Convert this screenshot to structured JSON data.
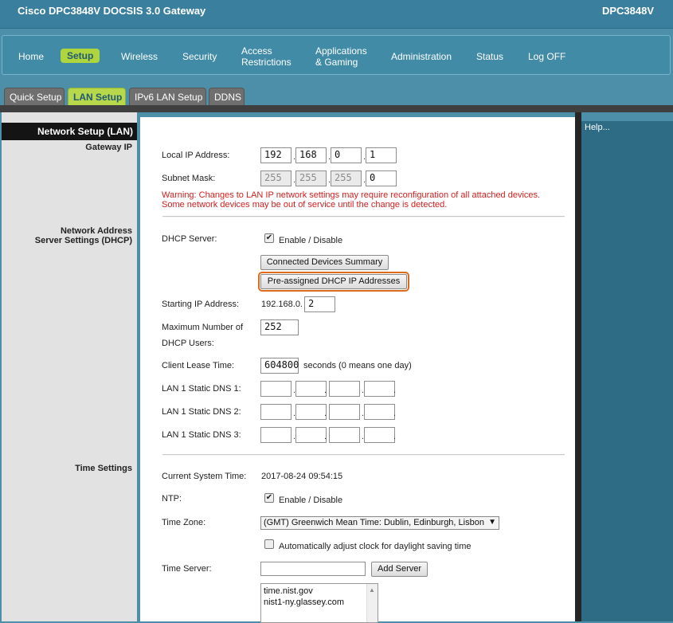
{
  "header": {
    "product": "Cisco DPC3848V DOCSIS 3.0 Gateway",
    "model": "DPC3848V"
  },
  "nav": {
    "home": "Home",
    "setup": "Setup",
    "wireless": "Wireless",
    "security": "Security",
    "access_1": "Access",
    "access_2": "Restrictions",
    "apps_1": "Applications",
    "apps_2": "& Gaming",
    "administration": "Administration",
    "status": "Status",
    "logoff": "Log OFF"
  },
  "tabs": {
    "quick": "Quick Setup",
    "lan": "LAN Setup",
    "ipv6": "IPv6 LAN Setup",
    "ddns": "DDNS"
  },
  "left": {
    "section_title": "Network Setup (LAN)",
    "gateway_ip": "Gateway IP",
    "dhcp_1": "Network Address",
    "dhcp_2": "Server Settings (DHCP)",
    "time": "Time Settings"
  },
  "help": "Help...",
  "gateway": {
    "local_ip_label": "Local IP Address:",
    "local_ip": [
      "192",
      "168",
      "0",
      "1"
    ],
    "subnet_label": "Subnet Mask:",
    "subnet": [
      "255",
      "255",
      "255",
      "0"
    ],
    "warning_1": "Warning: Changes to LAN IP network settings may require reconfiguration of all attached devices.",
    "warning_2": "Some network devices may be out of service until the change is detected."
  },
  "dhcp": {
    "server_label": "DHCP Server:",
    "enable_label": "Enable / Disable",
    "check": "✔",
    "connected_btn": "Connected Devices Summary",
    "preassigned_btn": "Pre-assigned DHCP IP Addresses",
    "start_label": "Starting IP Address:",
    "start_prefix": "192.168.0.",
    "start_value": "2",
    "max_label_1": "Maximum Number of",
    "max_label_2": "DHCP Users:",
    "max_value": "252",
    "lease_label": "Client Lease Time:",
    "lease_value": "604800",
    "lease_suffix": "seconds (0 means one day)",
    "dns1_label": "LAN 1 Static DNS 1:",
    "dns2_label": "LAN 1 Static DNS 2:",
    "dns3_label": "LAN 1 Static DNS 3:"
  },
  "time": {
    "current_label": "Current System Time:",
    "current_value": "2017-08-24 09:54:15",
    "ntp_label": "NTP:",
    "ntp_enable": "Enable / Disable",
    "ntp_check": "✔",
    "zone_label": "Time Zone:",
    "zone_value": "(GMT) Greenwich Mean Time: Dublin, Edinburgh, Lisbon",
    "zone_arrow": "▼",
    "dst_label": "Automatically adjust clock for daylight saving time",
    "server_label": "Time Server:",
    "add_server": "Add Server",
    "servers": [
      "time.nist.gov",
      "nist1-ny.glassey.com"
    ],
    "scroll_up": "▲",
    "scroll_down": "▼"
  }
}
